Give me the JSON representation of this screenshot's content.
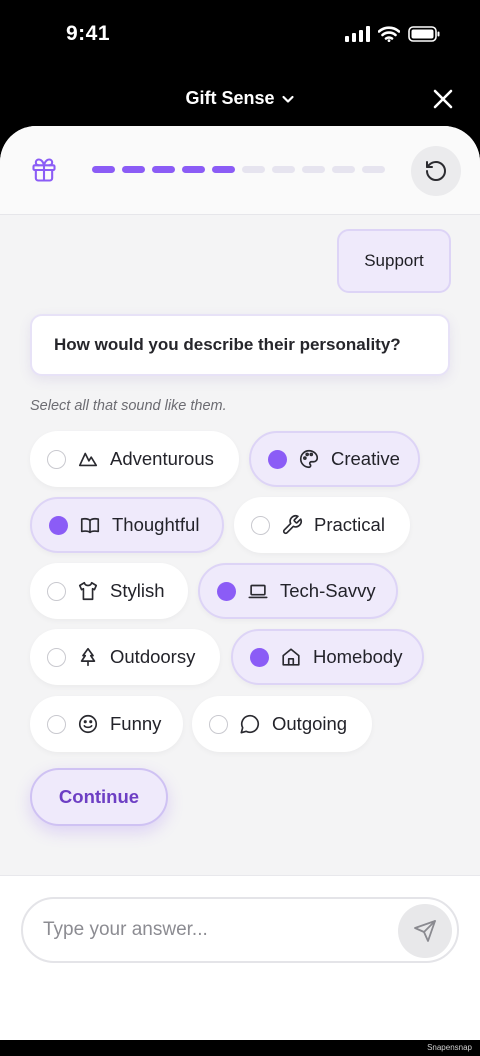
{
  "status_bar": {
    "time": "9:41"
  },
  "header": {
    "title": "Gift Sense"
  },
  "progress": {
    "total_steps": 10,
    "completed_steps": 5,
    "active_color": "#8b5cf6",
    "inactive_color": "#e6e4ef"
  },
  "conversation": {
    "user_reply": "Support",
    "question": "How would you describe their personality?",
    "hint": "Select all that sound like them."
  },
  "options": [
    {
      "label": "Adventurous",
      "icon": "mountain-icon",
      "selected": false
    },
    {
      "label": "Creative",
      "icon": "palette-icon",
      "selected": true
    },
    {
      "label": "Thoughtful",
      "icon": "book-icon",
      "selected": true
    },
    {
      "label": "Practical",
      "icon": "wrench-icon",
      "selected": false
    },
    {
      "label": "Stylish",
      "icon": "shirt-icon",
      "selected": false
    },
    {
      "label": "Tech-Savvy",
      "icon": "laptop-icon",
      "selected": true
    },
    {
      "label": "Outdoorsy",
      "icon": "tree-icon",
      "selected": false
    },
    {
      "label": "Homebody",
      "icon": "home-icon",
      "selected": true
    },
    {
      "label": "Funny",
      "icon": "smile-icon",
      "selected": false
    },
    {
      "label": "Outgoing",
      "icon": "chat-bubble-icon",
      "selected": false
    }
  ],
  "continue_label": "Continue",
  "composer": {
    "placeholder": "Type your answer..."
  },
  "watermark": "Snapensnap",
  "colors": {
    "accent": "#8b5cf6",
    "accent_text": "#6d3fc4",
    "selected_bg": "#efeafb"
  }
}
